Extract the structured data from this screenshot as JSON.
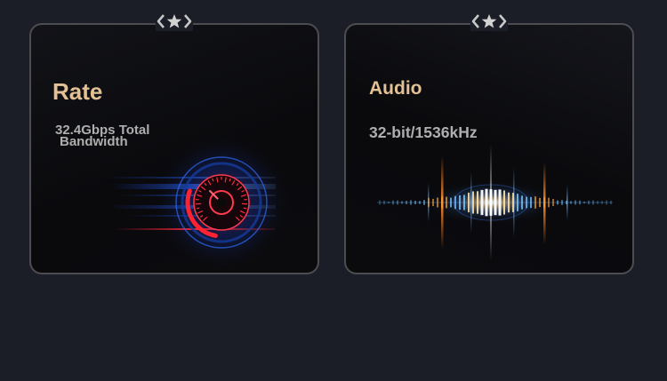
{
  "cards": [
    {
      "title": "Rate",
      "subtitle": "32.4Gbps Total Bandwidth",
      "graphic": "speedometer-icon",
      "badge": "star-badge-icon"
    },
    {
      "title": "Audio",
      "subtitle": "32-bit/1536kHz",
      "graphic": "audio-waveform-icon",
      "badge": "star-badge-icon"
    }
  ],
  "colors": {
    "background": "#1c1e27",
    "card_bg": "#0a0a0d",
    "card_border": "#4c4c51",
    "title": "#e3c194",
    "subtitle": "#aeaeae",
    "accent_blue": "#2f6fff",
    "accent_red": "#ff2a3e",
    "accent_orange": "#ffa23a"
  }
}
